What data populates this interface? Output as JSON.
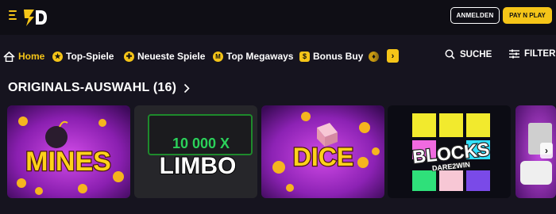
{
  "header": {
    "menu_icon": "hamburger-icon",
    "logo_icon": "brand-logo-icon",
    "login_label": "ANMELDEN",
    "pay_label": "PAY N PLAY",
    "accent_color": "#f5c518"
  },
  "nav": {
    "items": [
      {
        "label": "Home",
        "icon": "home-icon",
        "active": true
      },
      {
        "label": "Top-Spiele",
        "icon": "star-icon"
      },
      {
        "label": "Neueste Spiele",
        "icon": "new-icon"
      },
      {
        "label": "Top Megaways",
        "icon": "megaways-icon"
      },
      {
        "label": "Bonus Buy",
        "icon": "bonus-icon"
      }
    ],
    "more_arrow": "›",
    "search_label": "SUCHE",
    "filter_label": "FILTER"
  },
  "section": {
    "title": "ORIGINALS-AUSWAHL (16)"
  },
  "games": [
    {
      "title": "MINES"
    },
    {
      "title": "LIMBO",
      "multiplier": "10 000 X"
    },
    {
      "title": "DICE"
    },
    {
      "title": "BLOCKS",
      "subtitle": "DARE2WIN"
    }
  ]
}
